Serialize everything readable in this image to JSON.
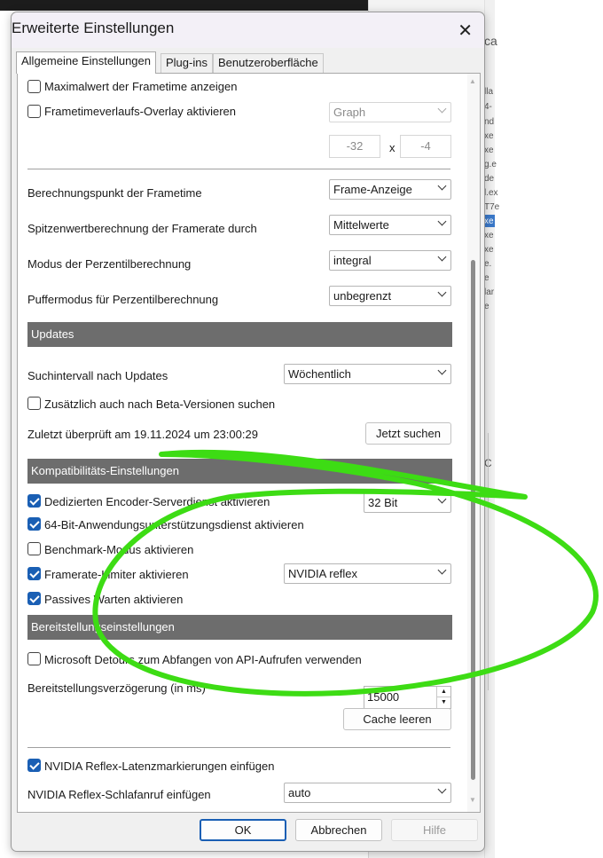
{
  "background": {
    "fragments": [
      "ca",
      "lla",
      "4-",
      "nd",
      "xe",
      "xe",
      "g.e",
      "de",
      "l.ex",
      "T7e",
      "xe",
      "xe",
      "xe",
      "e.",
      "e",
      "lar",
      "e",
      "C"
    ]
  },
  "dialog": {
    "title": "Erweiterte Einstellungen",
    "close_icon": "close-icon",
    "tabs": [
      {
        "label": "Allgemeine Einstellungen",
        "active": true
      },
      {
        "label": "Plug-ins",
        "active": false
      },
      {
        "label": "Benutzeroberfläche",
        "active": false
      }
    ],
    "frametime": {
      "max_label": "Maximalwert der Frametime anzeigen",
      "max_checked": false,
      "overlay_label": "Frametimeverlaufs-Overlay aktivieren",
      "overlay_checked": false,
      "overlay_select": "Graph",
      "size_w": "-32",
      "size_x": "x",
      "size_h": "-4"
    },
    "calc": {
      "point_label": "Berechnungspunkt der Frametime",
      "point_value": "Frame-Anzeige",
      "peak_label": "Spitzenwertberechnung der Framerate durch",
      "peak_value": "Mittelwerte",
      "perc_label": "Modus der Perzentilberechnung",
      "perc_value": "integral",
      "buffer_label": "Puffermodus für Perzentilberechnung",
      "buffer_value": "unbegrenzt"
    },
    "updates": {
      "header": "Updates",
      "interval_label": "Suchintervall nach Updates",
      "interval_value": "Wöchentlich",
      "beta_label": "Zusätzlich auch nach Beta-Versionen suchen",
      "beta_checked": false,
      "last_checked": "Zuletzt überprüft am 19.11.2024 um 23:00:29",
      "check_now": "Jetzt suchen"
    },
    "compat": {
      "header": "Kompatibilitäts-Einstellungen",
      "encoder_label": "Dedizierten Encoder-Serverdienst aktivieren",
      "encoder_checked": true,
      "encoder_value": "32 Bit",
      "x64_label": "64-Bit-Anwendungsunterstützungsdienst aktivieren",
      "x64_checked": true,
      "bench_label": "Benchmark-Modus aktivieren",
      "bench_checked": false,
      "limiter_label": "Framerate-Limiter aktivieren",
      "limiter_checked": true,
      "limiter_value": "NVIDIA reflex",
      "passive_label": "Passives Warten aktivieren",
      "passive_checked": true
    },
    "deploy": {
      "header": "Bereitstellungseinstellungen",
      "detours_label": "Microsoft Detours zum Abfangen von API-Aufrufen verwenden",
      "detours_checked": false,
      "delay_label": "Bereitstellungsverzögerung (in ms)",
      "delay_value": "15000",
      "clear_cache": "Cache leeren"
    },
    "reflex": {
      "markers_label": "NVIDIA Reflex-Latenzmarkierungen einfügen",
      "markers_checked": true,
      "sleep_label": "NVIDIA Reflex-Schlafanruf einfügen",
      "sleep_value": "auto"
    },
    "buttons": {
      "ok": "OK",
      "cancel": "Abbrechen",
      "help": "Hilfe"
    }
  },
  "colors": {
    "accent": "#1a5fb4",
    "section_header": "#6d6d6d",
    "annotation_stroke": "#3ddc14"
  }
}
